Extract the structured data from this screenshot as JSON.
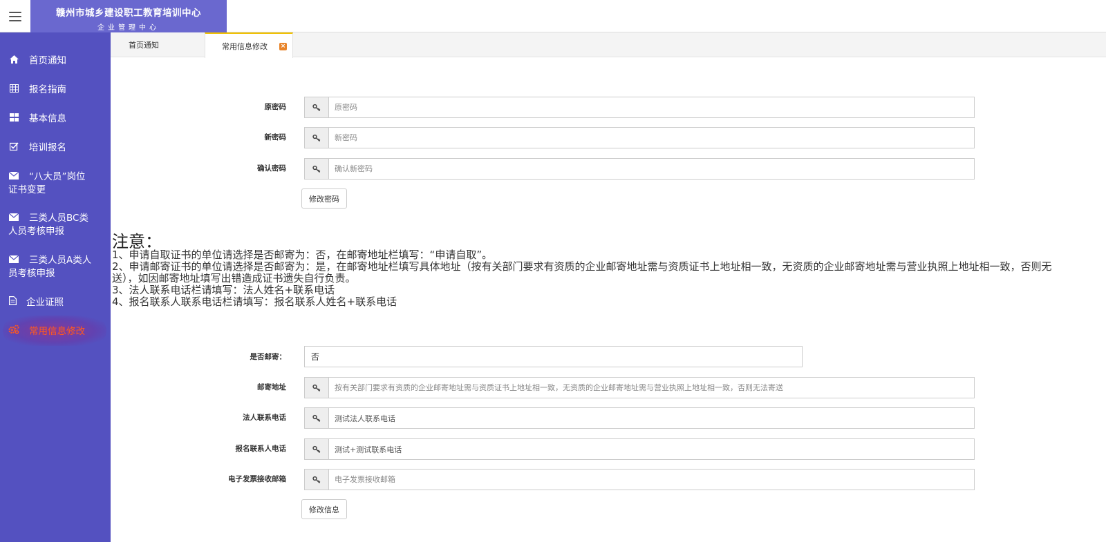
{
  "header": {
    "menu_icon": "hamburger-menu-icon",
    "title": "赣州市城乡建设职工教育培训中心",
    "subtitle": "企业管理中心"
  },
  "sidebar": {
    "items": [
      {
        "icon": "home-icon",
        "label": "首页通知"
      },
      {
        "icon": "grid-icon",
        "label": "报名指南"
      },
      {
        "icon": "dashboard-icon",
        "label": "基本信息"
      },
      {
        "icon": "checkbox-icon",
        "label": "培训报名"
      },
      {
        "icon": "envelope-icon",
        "label_line1": "“八大员”岗位",
        "label_line2": "证书变更"
      },
      {
        "icon": "envelope-icon",
        "label_line1": "三类人员BC类",
        "label_line2": "人员考核申报"
      },
      {
        "icon": "envelope-icon",
        "label_line1": "三类人员A类人",
        "label_line2": "员考核申报"
      },
      {
        "icon": "document-icon",
        "label": "企业证照"
      },
      {
        "icon": "gears-icon",
        "label": "常用信息修改"
      }
    ],
    "active_color": "#ff5a1f"
  },
  "tabs": {
    "home": "首页通知",
    "current": "常用信息修改",
    "close_icon": "close-icon"
  },
  "password_form": {
    "old_label": "原密码",
    "old_placeholder": "原密码",
    "new_label": "新密码",
    "new_placeholder": "新密码",
    "confirm_label": "确认密码",
    "confirm_placeholder": "确认新密码",
    "key_icon": "key-icon",
    "submit_label": "修改密码"
  },
  "notice": {
    "title": "注意：",
    "lines": [
      "1、申请自取证书的单位请选择是否邮寄为：否，在邮寄地址栏填写：“申请自取”。",
      "2、申请邮寄证书的单位请选择是否邮寄为：是，在邮寄地址栏填写具体地址（按有关部门要求有资质的企业邮寄地址需与资质证书上地址相一致，无资质的企业邮寄地址需与营业执照上地址相一致，否则无",
      "送），如因邮寄地址填写出错造成证书遗失自行负责。",
      "3、法人联系电话栏请填写：法人姓名+联系电话",
      "4、报名联系人联系电话栏请填写：报名联系人姓名+联系电话"
    ]
  },
  "info_form": {
    "mail_label": "是否邮寄：",
    "mail_value": "否",
    "address_label": "邮寄地址",
    "address_placeholder": "按有关部门要求有资质的企业邮寄地址需与资质证书上地址相一致，无资质的企业邮寄地址需与营业执照上地址相一致，否则无法寄送",
    "legal_phone_label": "法人联系电话",
    "legal_phone_value": "测试法人联系电话",
    "contact_phone_label": "报名联系人电话",
    "contact_phone_value": "测试+测试联系电话",
    "email_label": "电子发票接收邮箱",
    "email_placeholder": "电子发票接收邮箱",
    "submit_label": "修改信息"
  }
}
